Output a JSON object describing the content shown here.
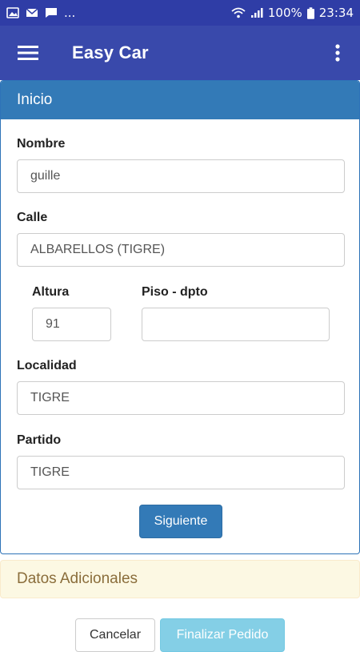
{
  "status_bar": {
    "left_icons": [
      "image-icon",
      "mail-icon",
      "chat-icon"
    ],
    "more": "...",
    "battery": "100%",
    "time": "23:34"
  },
  "app_bar": {
    "title": "Easy Car",
    "menu_icon": "hamburger-menu-icon",
    "overflow_icon": "more-vert-icon"
  },
  "panel_inicio": {
    "header": "Inicio",
    "fields": {
      "nombre": {
        "label": "Nombre",
        "value": "guille"
      },
      "calle": {
        "label": "Calle",
        "value": "ALBARELLOS (TIGRE)"
      },
      "altura": {
        "label": "Altura",
        "value": "91"
      },
      "piso": {
        "label": "Piso - dpto",
        "value": ""
      },
      "localidad": {
        "label": "Localidad",
        "value": "TIGRE"
      },
      "partido": {
        "label": "Partido",
        "value": "TIGRE"
      }
    },
    "next_button": "Siguiente"
  },
  "panel_datos": {
    "header": "Datos Adicionales"
  },
  "footer": {
    "cancel": "Cancelar",
    "finish": "Finalizar Pedido"
  },
  "colors": {
    "status_bar": "#2f3da6",
    "app_bar": "#3949ab",
    "primary": "#337ab7",
    "info": "#5bc0de",
    "warning_bg": "#fcf8e3",
    "warning_text": "#8a6d3b"
  }
}
